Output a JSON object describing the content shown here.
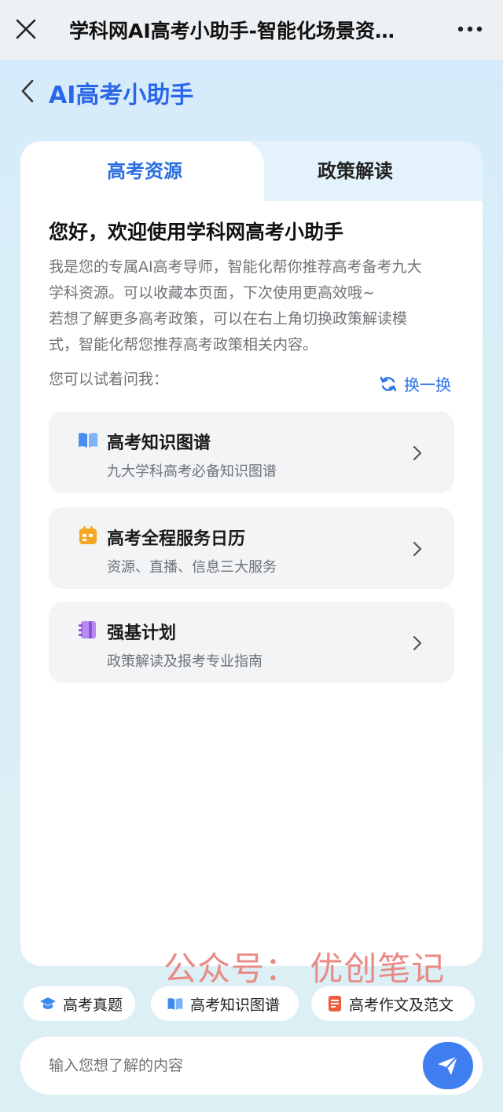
{
  "window": {
    "title": "学科网AI高考小助手-智能化场景资…"
  },
  "header": {
    "title": "AI高考小助手"
  },
  "tabs": [
    {
      "label": "高考资源",
      "active": true
    },
    {
      "label": "政策解读",
      "active": false
    }
  ],
  "main": {
    "greeting": "您好，欢迎使用学科网高考小助手",
    "intro_lines": [
      "我是您的专属AI高考导师，智能化帮你推荐高考备考九大",
      "学科资源。可以收藏本页面，下次使用更高效哦~",
      "若想了解更多高考政策，可以在右上角切换政策解读模",
      "式，智能化帮您推荐高考政策相关内容。"
    ],
    "try_label": "您可以试着问我：",
    "refresh_label": "换一换"
  },
  "suggestions": [
    {
      "title": "高考知识图谱",
      "subtitle": "九大学科高考必备知识图谱",
      "icon": "book-icon",
      "color": "#4a8df0"
    },
    {
      "title": "高考全程服务日历",
      "subtitle": "资源、直播、信息三大服务",
      "icon": "calendar-icon",
      "color": "#f5a623"
    },
    {
      "title": "强基计划",
      "subtitle": "政策解读及报考专业指南",
      "icon": "notebook-icon",
      "color": "#a06be8"
    }
  ],
  "watermark": "公众号：  优创笔记",
  "quick_chips": [
    {
      "label": "高考真题",
      "icon": "graduation-cap-icon",
      "color": "#3d8bf0"
    },
    {
      "label": "高考知识图谱",
      "icon": "book-icon",
      "color": "#3d8bf0"
    },
    {
      "label": "高考作文及范文",
      "icon": "document-icon",
      "color": "#ef5d3e"
    }
  ],
  "input": {
    "placeholder": "输入您想了解的内容",
    "value": ""
  },
  "colors": {
    "accent": "#2b66e8",
    "send_button": "#3f7ef0"
  }
}
